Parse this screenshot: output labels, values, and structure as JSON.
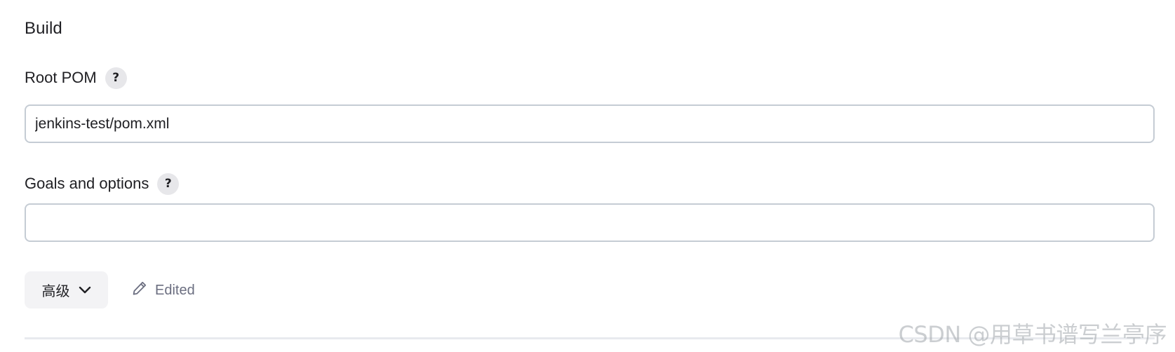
{
  "section": {
    "title": "Build"
  },
  "root_pom": {
    "label": "Root POM",
    "help_label": "?",
    "value": "jenkins-test/pom.xml"
  },
  "goals": {
    "label": "Goals and options",
    "help_label": "?",
    "value": ""
  },
  "advanced": {
    "label": "高级",
    "icon": "chevron-down-icon"
  },
  "edited": {
    "label": "Edited",
    "icon": "pencil-icon"
  },
  "watermark": {
    "text": "CSDN @用草书谱写兰亭序"
  },
  "colors": {
    "input_border": "#c5ccd4",
    "help_bg": "#e7e7ea",
    "advanced_bg": "#f3f3f5",
    "edited_text": "#6b6e80"
  }
}
